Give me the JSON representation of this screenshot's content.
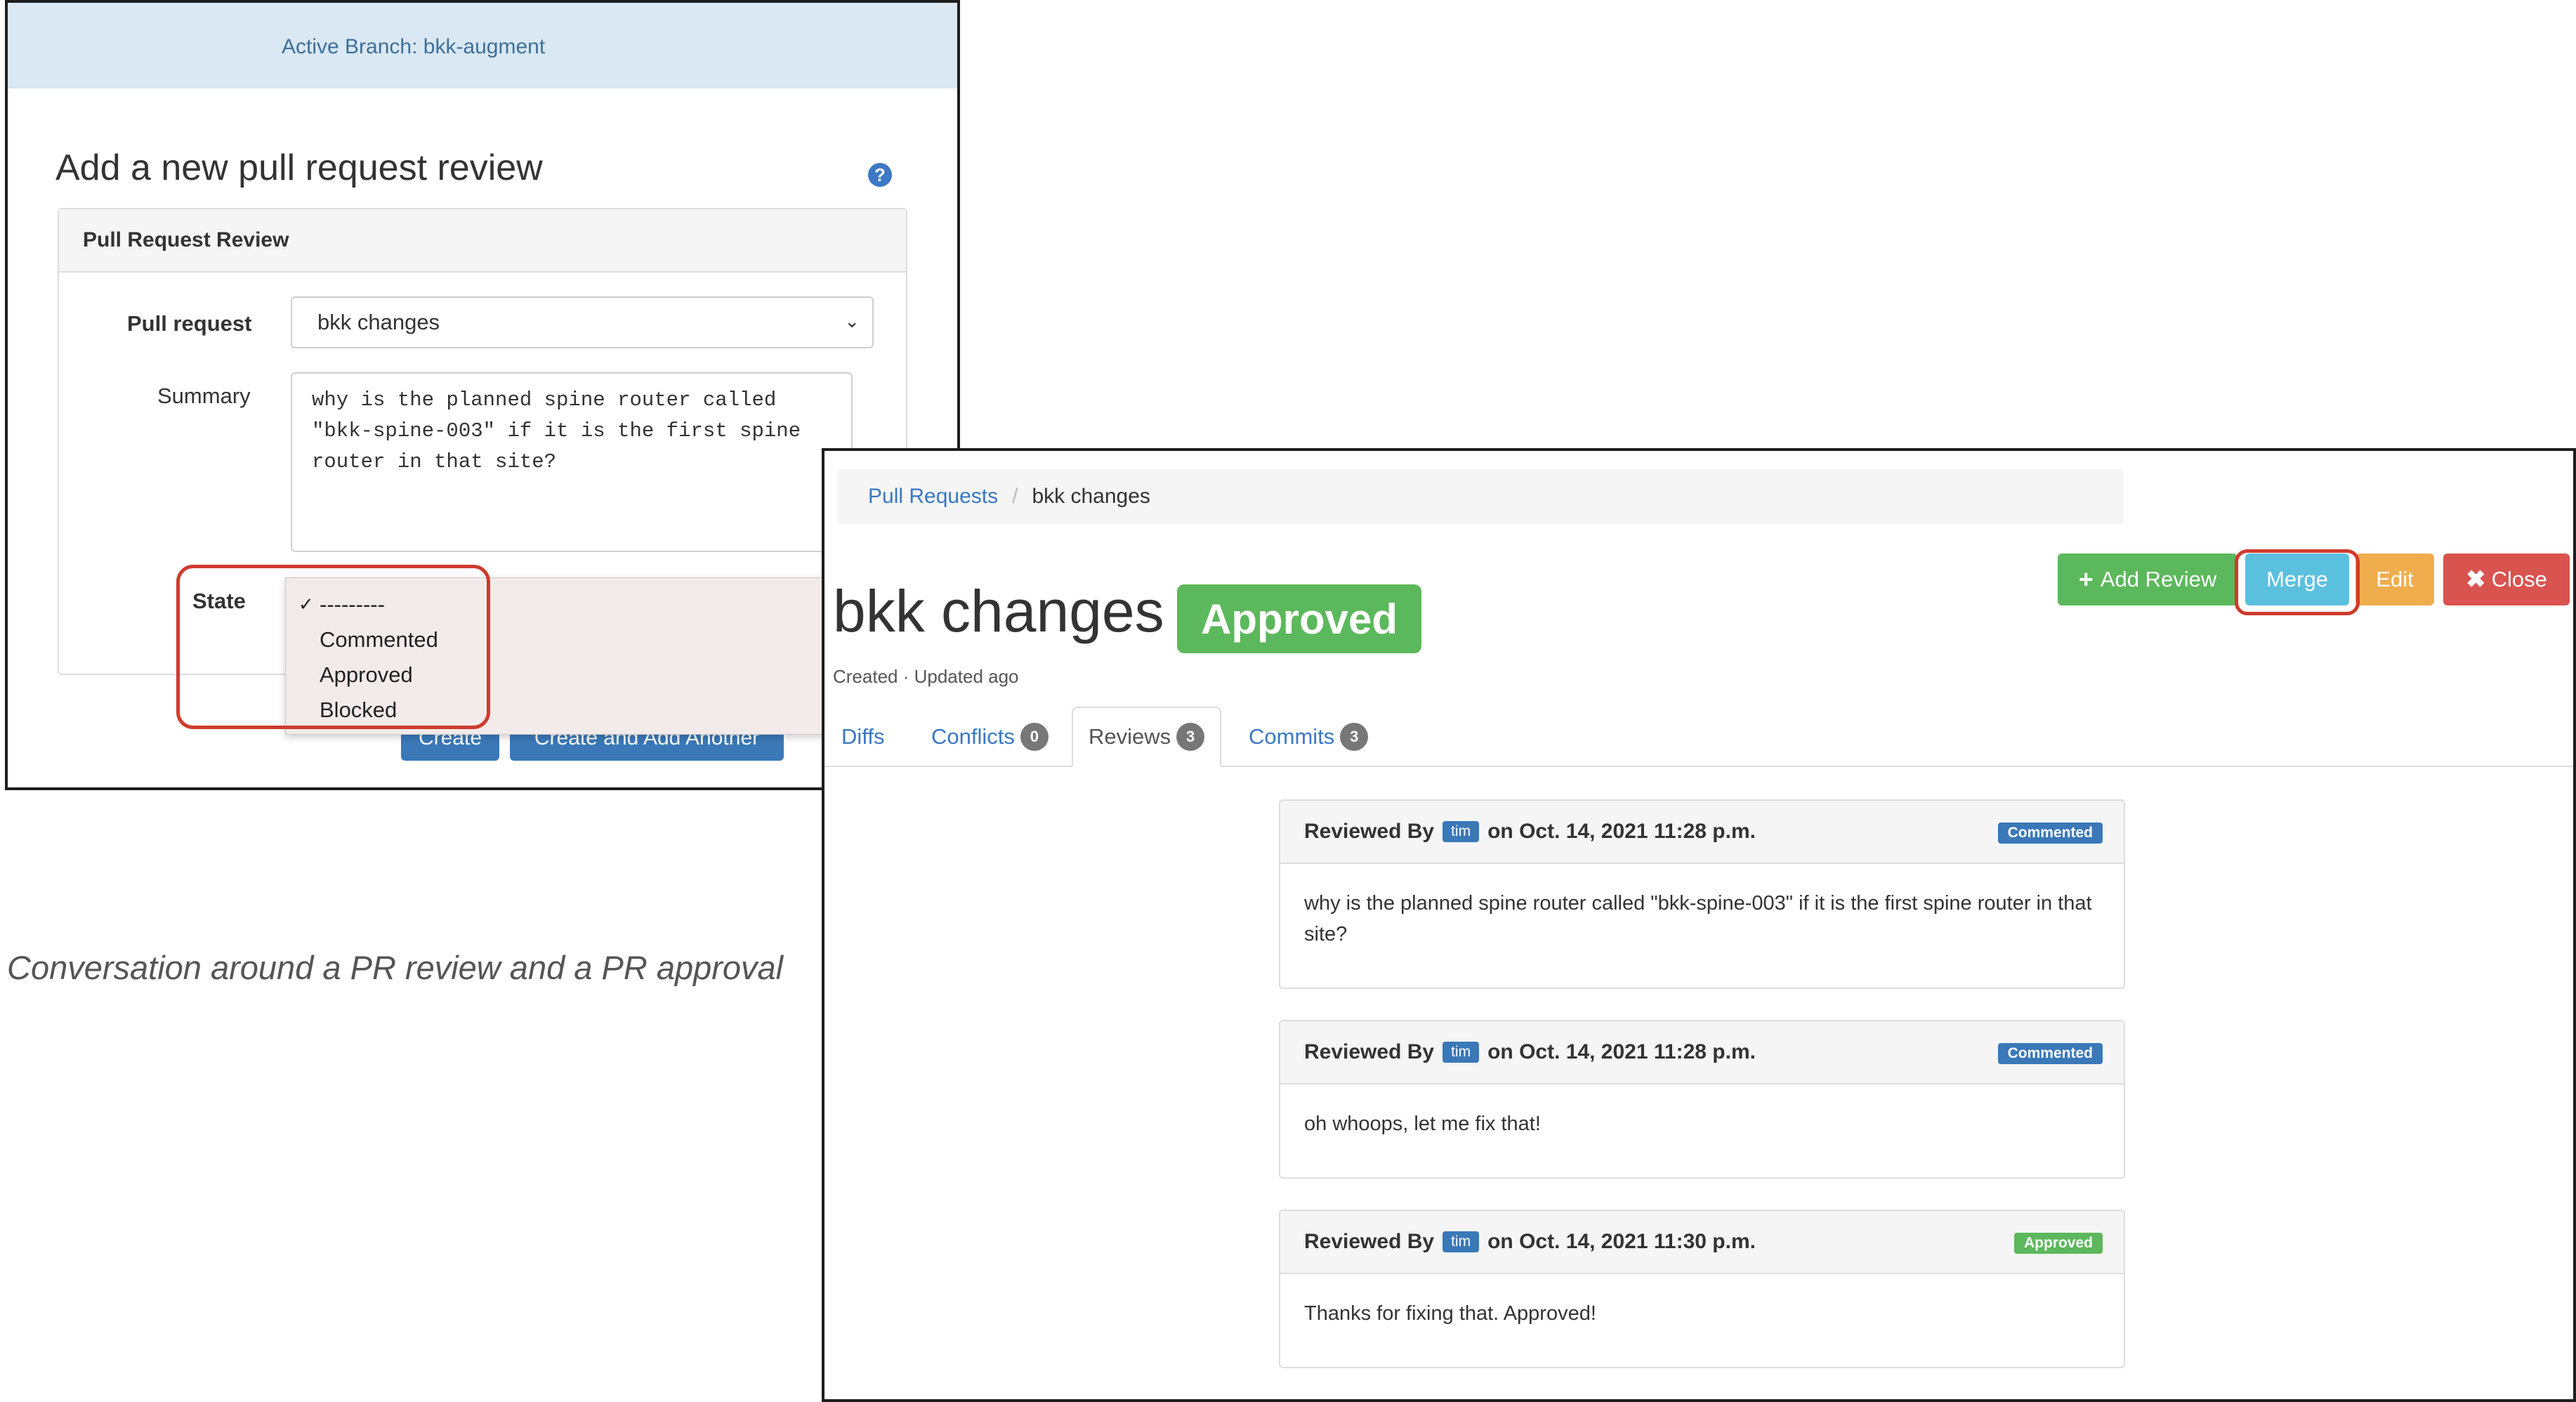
{
  "left_screenshot": {
    "branch_bar": "Active Branch: bkk-augment",
    "heading": "Add a new pull request review",
    "help_icon": "question-circle-icon",
    "panel_title": "Pull Request Review",
    "fields": {
      "pull_request_label": "Pull request",
      "pull_request_value": "bkk changes",
      "summary_label": "Summary",
      "summary_value": "why is the planned spine router called \"bkk-spine-003\" if it is the first spine router in that site?",
      "state_label": "State"
    },
    "state_options": [
      "---------",
      "Commented",
      "Approved",
      "Blocked"
    ],
    "buttons": {
      "create": "Create",
      "create_another": "Create and Add Another"
    },
    "highlight_color": "#cf3b2e"
  },
  "caption": "Conversation around a PR review and a PR approval",
  "right_screenshot": {
    "breadcrumb": {
      "parent": "Pull Requests",
      "current": "bkk changes"
    },
    "title": "bkk changes",
    "status": "Approved",
    "meta": "Created · Updated ago",
    "actions": {
      "add_review": "Add Review",
      "merge": "Merge",
      "edit": "Edit",
      "close": "Close"
    },
    "tabs": [
      {
        "label": "Diffs",
        "count": ""
      },
      {
        "label": "Conflicts",
        "count": "0"
      },
      {
        "label": "Reviews",
        "count": "3"
      },
      {
        "label": "Commits",
        "count": "3"
      }
    ],
    "reviews": [
      {
        "prefix": "Reviewed By",
        "user": "tim",
        "date": "on Oct. 14, 2021 11:28 p.m.",
        "state": "Commented",
        "body": "why is the planned spine router called \"bkk-spine-003\" if it is the first spine router in that site?"
      },
      {
        "prefix": "Reviewed By",
        "user": "tim",
        "date": "on Oct. 14, 2021 11:28 p.m.",
        "state": "Commented",
        "body": "oh whoops, let me fix that!"
      },
      {
        "prefix": "Reviewed By",
        "user": "tim",
        "date": "on Oct. 14, 2021 11:30 p.m.",
        "state": "Approved",
        "body": "Thanks for fixing that. Approved!"
      }
    ],
    "colors": {
      "approved": "#5cb85c",
      "commented": "#3a78b8",
      "merge": "#5bc0de",
      "edit": "#f0ad4e",
      "close": "#d9534f"
    }
  }
}
